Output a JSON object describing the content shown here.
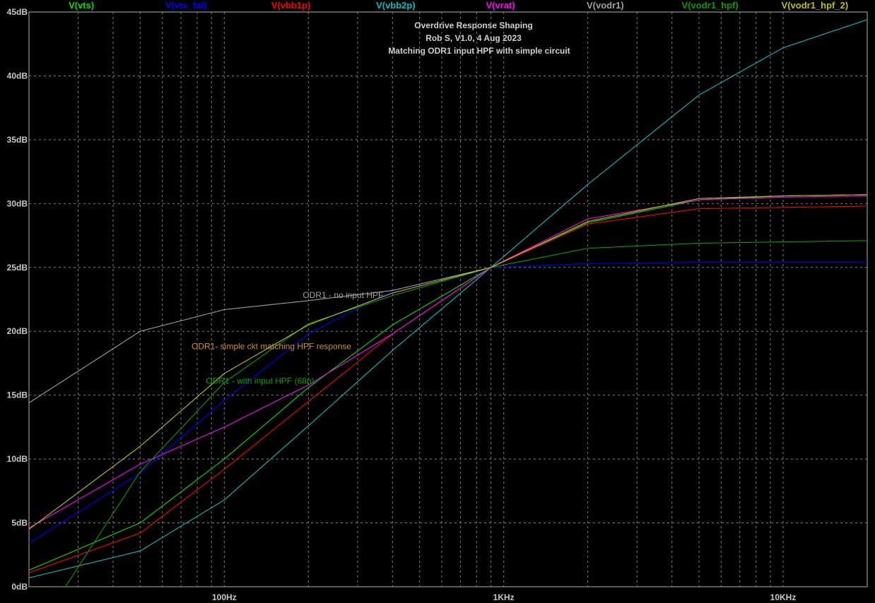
{
  "chart_data": {
    "type": "line",
    "title_lines": [
      "Overdrive Response Shaping",
      "Rob S, V1.0, 4 Aug 2023",
      "Matching ODR1 input HPF with simple circuit"
    ],
    "x_scale": "log",
    "xlim": [
      20,
      20000
    ],
    "ylim": [
      0,
      45
    ],
    "y_ticks": [
      0,
      5,
      10,
      15,
      20,
      25,
      30,
      35,
      40,
      45
    ],
    "y_tick_labels": [
      "0dB",
      "5dB",
      "10dB",
      "15dB",
      "20dB",
      "25dB",
      "30dB",
      "35dB",
      "40dB",
      "45dB"
    ],
    "x_ticks": [
      100,
      1000,
      10000
    ],
    "x_tick_labels": [
      "100Hz",
      "1KHz",
      "10KHz"
    ],
    "grid": true,
    "legend_position": "top",
    "series": [
      {
        "name": "V(vts)",
        "color": "#00e000",
        "x": [
          20,
          50,
          100,
          200,
          400,
          900,
          2000,
          5000,
          10000,
          20000
        ],
        "y": [
          1.3,
          5,
          10,
          15.6,
          20.5,
          25,
          28.5,
          30.3,
          30.6,
          30.7
        ]
      },
      {
        "name": "V(vts_fat)",
        "color": "#0000ff",
        "x": [
          20,
          50,
          100,
          200,
          400,
          900,
          2000,
          5000,
          10000,
          20000
        ],
        "y": [
          3.4,
          8.9,
          14.6,
          19.8,
          23.2,
          25,
          25.3,
          25.4,
          25.4,
          25.4
        ]
      },
      {
        "name": "V(vbb1p)",
        "color": "#ff0000",
        "x": [
          20,
          50,
          100,
          200,
          400,
          900,
          2000,
          5000,
          10000,
          20000
        ],
        "y": [
          1.1,
          4.2,
          9.2,
          14.5,
          19.8,
          25,
          28.4,
          29.6,
          29.7,
          29.8
        ]
      },
      {
        "name": "V(vbb2p)",
        "color": "#00c0c0",
        "x": [
          20,
          50,
          100,
          200,
          400,
          900,
          2000,
          5000,
          10000,
          20000
        ],
        "y": [
          0.7,
          2.8,
          6.8,
          12.6,
          18.5,
          25,
          31.5,
          38.5,
          42.2,
          44.4
        ]
      },
      {
        "name": "V(vrat)",
        "color": "#ff00ff",
        "x": [
          20,
          50,
          100,
          200,
          400,
          900,
          2000,
          5000,
          10000,
          20000
        ],
        "y": [
          4.6,
          9.6,
          12.5,
          15.8,
          19.8,
          25,
          28.8,
          30.3,
          30.5,
          30.6
        ]
      },
      {
        "name": "V(vodr1)",
        "color": "#a0a0a0",
        "x": [
          20,
          50,
          100,
          200,
          400,
          900
        ],
        "y": [
          14.4,
          20,
          21.7,
          22.4,
          23.2,
          25
        ]
      },
      {
        "name": "V(vodr1_hpf)",
        "color": "#00a000",
        "x": [
          27,
          50,
          100,
          200,
          400,
          900,
          2000,
          5000,
          10000,
          20000
        ],
        "y": [
          0,
          9,
          16,
          20.6,
          22.8,
          25,
          26.5,
          26.9,
          27,
          27.1
        ]
      },
      {
        "name": "V(vodr1_hpf_2)",
        "color": "#c0c000",
        "x": [
          20,
          50,
          100,
          200,
          400,
          900,
          2000,
          5000,
          10000,
          20000
        ],
        "y": [
          4.5,
          11,
          16.7,
          20.5,
          23,
          25,
          28.6,
          30.4,
          30.6,
          30.7
        ]
      }
    ],
    "annotations": [
      {
        "text": "ODR1 - no input HPF",
        "color": "#a0a0a0",
        "x": 200,
        "y": 22.6
      },
      {
        "text": "ODR1- simple ckt matching HPF response",
        "color": "#d09020",
        "x": 80,
        "y": 18.6
      },
      {
        "text": "ODR1 - with input HPF (68n)",
        "color": "#00a000",
        "x": 90,
        "y": 15.9
      }
    ]
  }
}
